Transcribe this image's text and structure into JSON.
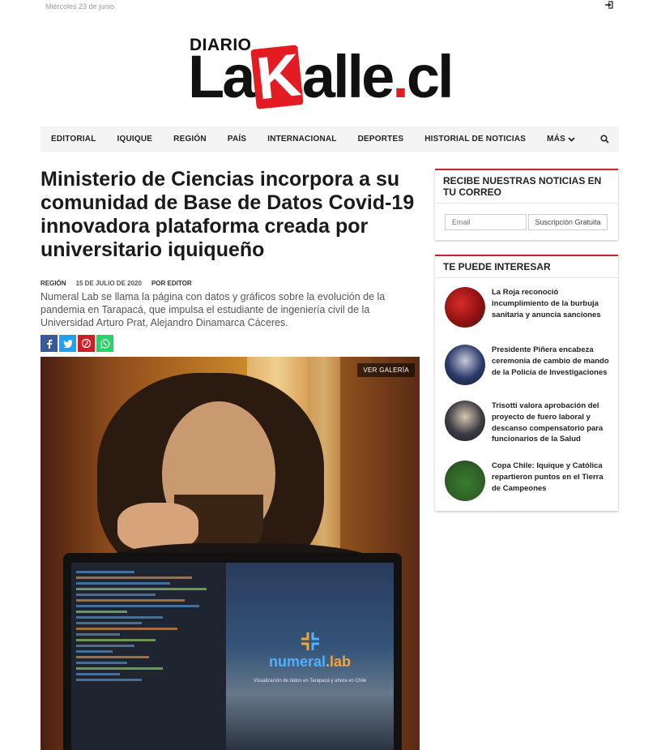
{
  "top_bar": {
    "date": "Miércoles 23 de junio",
    "login_icon": "sign-in-icon"
  },
  "logo": {
    "prefix": "DIARIO",
    "part1": "La",
    "k": "K",
    "part2": "alle",
    "dot": ".",
    "tld": "cl",
    "brand_color": "#e31c23"
  },
  "nav": {
    "items": [
      "EDITORIAL",
      "IQUIQUE",
      "REGIÓN",
      "PAÍS",
      "INTERNACIONAL",
      "DEPORTES",
      "HISTORIAL DE NOTICIAS",
      "MÁS"
    ],
    "more_icon": "chevron-down-icon",
    "search_icon": "search-icon"
  },
  "article": {
    "title": "Ministerio de Ciencias incorpora a su comunidad de Base de Datos Covid-19 innovadora plataforma creada por universitario iquiqueño",
    "section": "REGIÓN",
    "date": "15 DE JULIO DE 2020",
    "author_prefix": "POR",
    "author": "EDITOR",
    "lead": "Numeral Lab se llama la página con datos y gráficos sobre la evolución de la pandemia en Tarapacá, que impulsa el estudiante de ingeniería civil de la Universidad Arturo Prat, Alejandro Dinamarca Cáceres.",
    "share_icons": [
      "facebook-icon",
      "twitter-icon",
      "pinterest-icon",
      "whatsapp-icon"
    ],
    "gallery_label": "VER GALERÍA",
    "photo_text": {
      "logo_a": "numeral",
      "logo_b": ".lab",
      "tagline": "Visualización de datos en Tarapacá y ahora en Chile"
    }
  },
  "sidebar": {
    "newsletter": {
      "title": "RECIBE NUESTRAS NOTICIAS EN TU CORREO",
      "email_placeholder": "Email",
      "button": "Suscripción Gratuita"
    },
    "interest": {
      "title": "TE PUEDE INTERESAR",
      "items": [
        {
          "title": "La Roja reconoció incumplimiento de la burbuja sanitaria y anuncia sanciones"
        },
        {
          "title": "Presidente Piñera encabeza ceremonia de cambio de mando de la Policía de Investigaciones"
        },
        {
          "title": "Trisotti valora aprobación del proyecto de fuero laboral y descanso compensatorio para funcionarios de la Salud"
        },
        {
          "title": "Copa Chile: Iquique y Católica repartieron puntos en el Tierra de Campeones"
        }
      ]
    }
  }
}
